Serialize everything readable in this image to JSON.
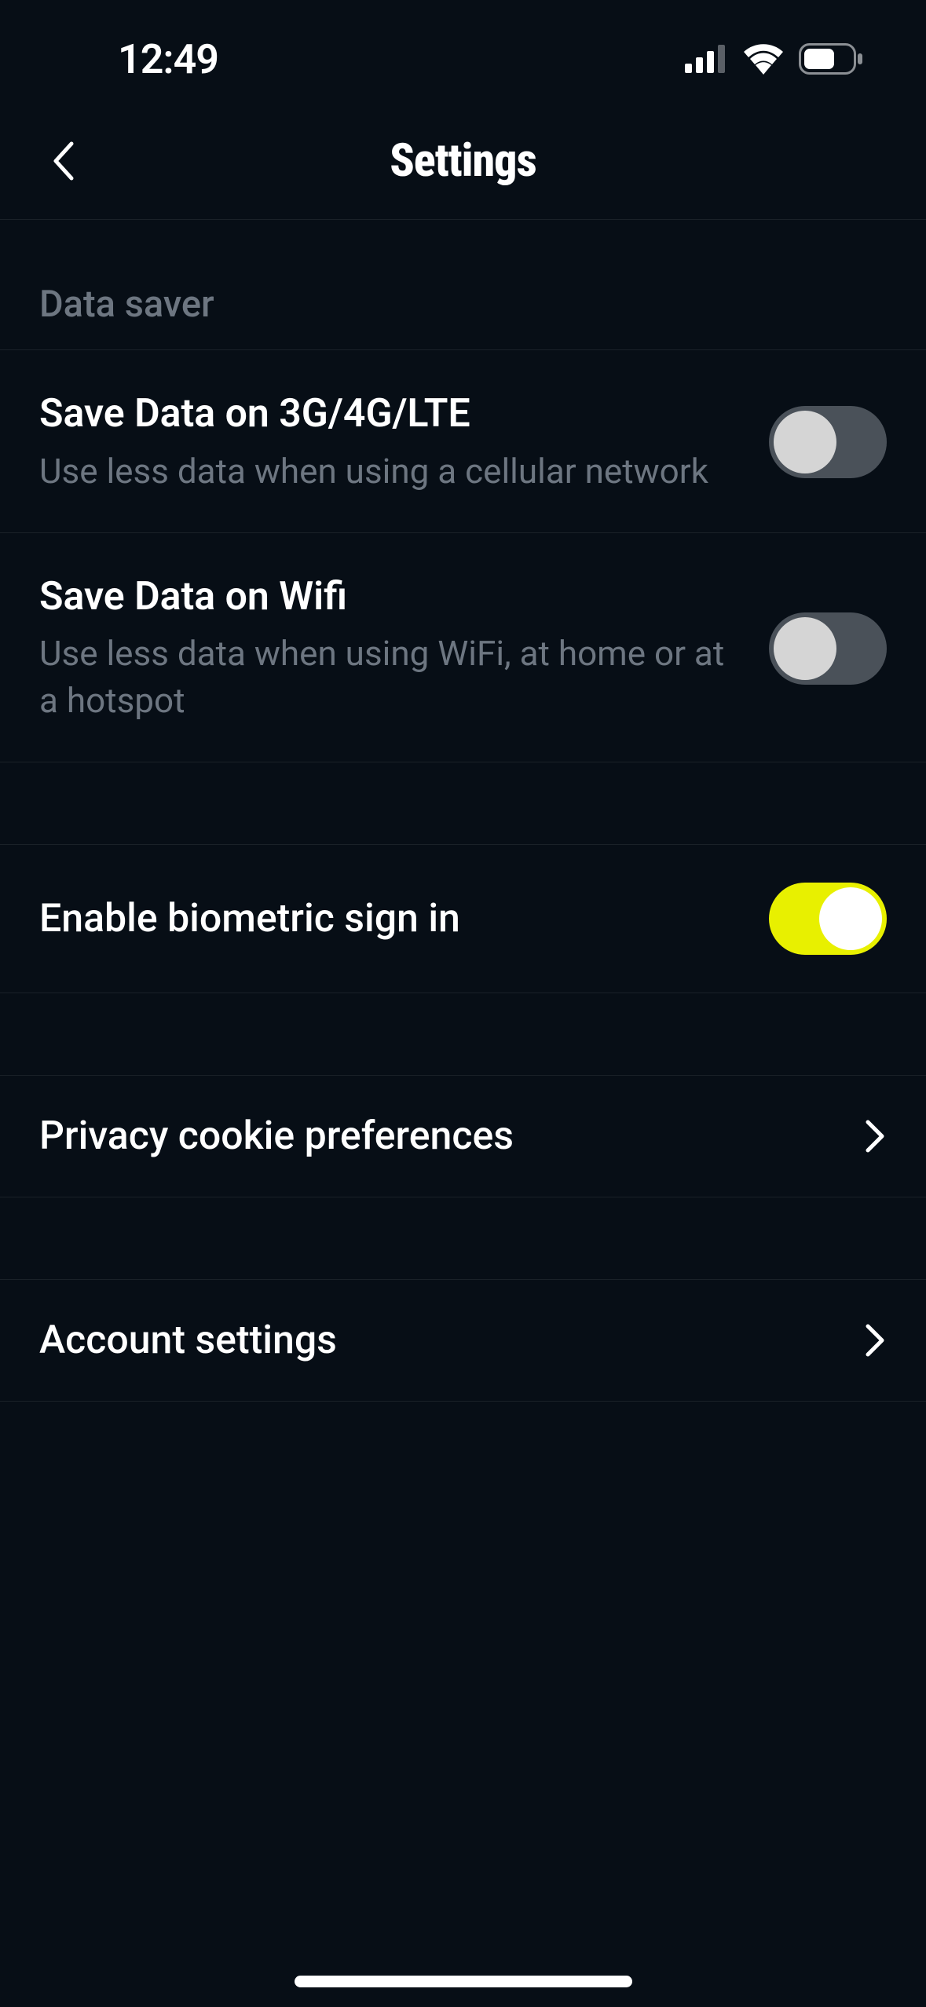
{
  "statusBar": {
    "time": "12:49"
  },
  "header": {
    "title": "Settings"
  },
  "sections": {
    "dataSaver": {
      "header": "Data saver",
      "saveCellular": {
        "title": "Save Data on 3G/4G/LTE",
        "subtitle": "Use less data when using a cellular network",
        "enabled": false
      },
      "saveWifi": {
        "title": "Save Data on Wifi",
        "subtitle": "Use less data when using WiFi, at home or at a hotspot",
        "enabled": false
      }
    },
    "biometric": {
      "title": "Enable biometric sign in",
      "enabled": true
    },
    "privacy": {
      "title": "Privacy cookie preferences"
    },
    "account": {
      "title": "Account settings"
    }
  }
}
